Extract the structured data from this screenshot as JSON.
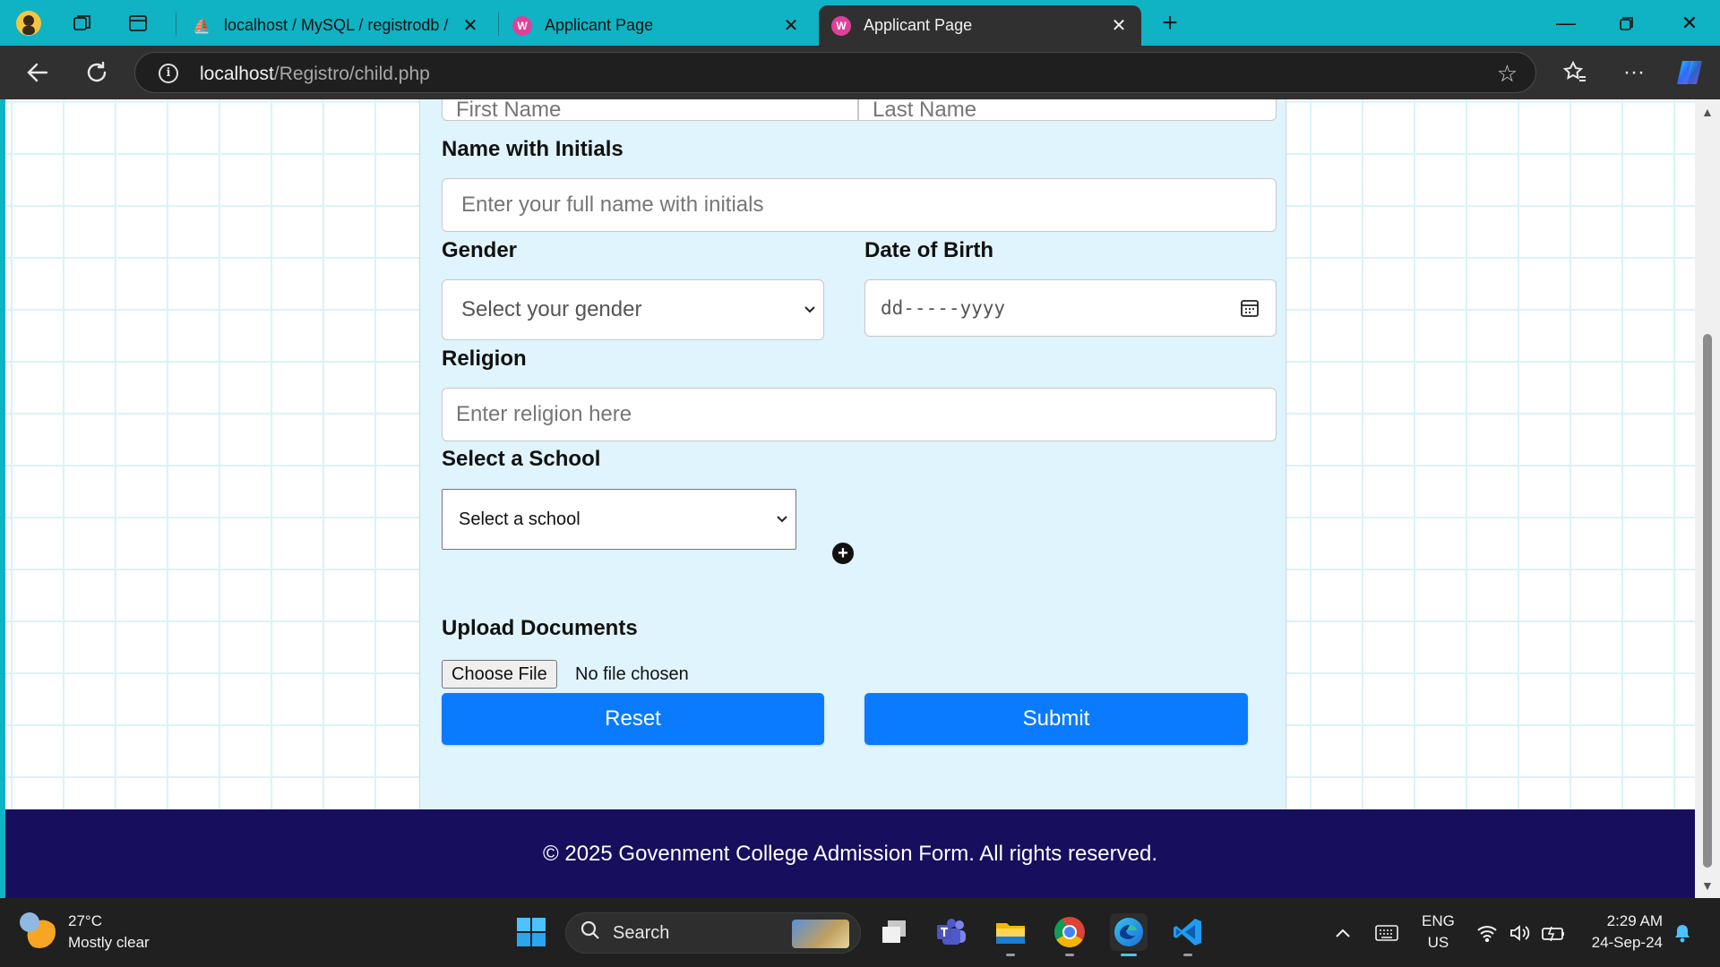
{
  "browser": {
    "tabs": [
      {
        "title": "localhost / MySQL / registrodb / c",
        "favicon": "phpmyadmin-icon",
        "active": false
      },
      {
        "title": "Applicant Page",
        "favicon": "webpage-icon",
        "active": false
      },
      {
        "title": "Applicant Page",
        "favicon": "webpage-icon",
        "active": true
      }
    ],
    "new_tab_label": "+",
    "url_host": "localhost",
    "url_path": "/Registro/child.php"
  },
  "form": {
    "first_name_placeholder": "First Name",
    "last_name_placeholder": "Last Name",
    "name_initials_label": "Name with Initials",
    "name_initials_placeholder": "Enter your full name with initials",
    "gender_label": "Gender",
    "gender_selected": "Select your gender",
    "dob_label": "Date of Birth",
    "dob_placeholder": "dd-----yyyy",
    "religion_label": "Religion",
    "religion_placeholder": "Enter religion here",
    "school_label": "Select a School",
    "school_selected": "Select a school",
    "upload_label": "Upload Documents",
    "choose_file_label": "Choose File",
    "file_status": "No file chosen",
    "reset_label": "Reset",
    "submit_label": "Submit",
    "accent_color": "#0a7bff",
    "card_color": "#dff4fd"
  },
  "footer": {
    "text": "© 2025 Govenment College Admission Form. All rights reserved.",
    "background": "#170e5e"
  },
  "taskbar": {
    "weather_temp": "27°C",
    "weather_desc": "Mostly clear",
    "search_label": "Search",
    "lang_top": "ENG",
    "lang_bottom": "US",
    "time": "2:29 AM",
    "date": "24-Sep-24"
  }
}
